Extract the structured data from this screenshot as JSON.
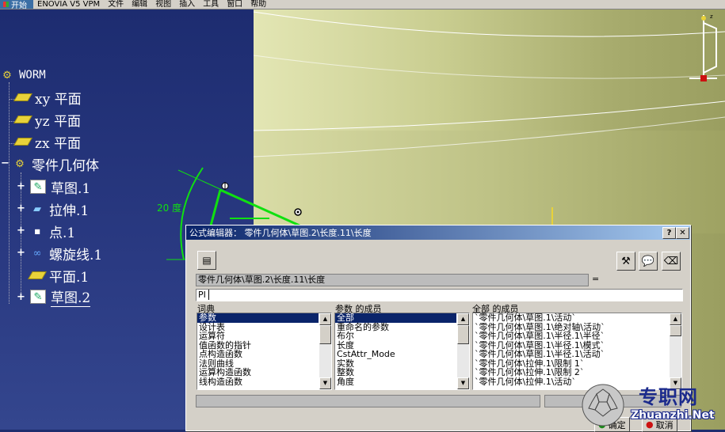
{
  "menubar": {
    "start": "开始",
    "items": [
      "ENOVIA V5 VPM",
      "文件",
      "编辑",
      "视图",
      "插入",
      "工具",
      "窗口",
      "帮助"
    ]
  },
  "tree": {
    "root": "WORM",
    "planes": [
      "xy 平面",
      "yz 平面",
      "zx 平面"
    ],
    "body": "零件几何体",
    "features": [
      "草图.1",
      "拉伸.1",
      "点.1",
      "螺旋线.1",
      "平面.1",
      "草图.2"
    ]
  },
  "sketch": {
    "angle_label": "20 度"
  },
  "compass": {
    "z_label": "z"
  },
  "dialog": {
    "title": "公式编辑器： 零件几何体\\草图.2\\长度.11\\长度",
    "help_btn": "?",
    "close_btn": "✕",
    "param_path": "零件几何体\\草图.2\\长度.11\\长度",
    "equals": "=",
    "formula_value": "PI",
    "dictionary_label": "词典",
    "members_label": "参数 的成员",
    "all_members_label": "全部 的成员",
    "dictionary_items": [
      "参数",
      "设计表",
      "运算符",
      "值函数的指针",
      "点构造函数",
      "法则曲线",
      "运算构造函数",
      "线构造函数"
    ],
    "member_items": [
      "全部",
      "重命名的参数",
      "布尔",
      "长度",
      "CstAttr_Mode",
      "实数",
      "整数",
      "角度"
    ],
    "all_items": [
      "`零件几何体\\草图.1\\活动`",
      "`零件几何体\\草图.1\\绝对轴\\活动`",
      "`零件几何体\\草图.1\\半径.1\\半径`",
      "`零件几何体\\草图.1\\半径.1\\模式`",
      "`零件几何体\\草图.1\\半径.1\\活动`",
      "`零件几何体\\拉伸.1\\限制 1`",
      "`零件几何体\\拉伸.1\\限制 2`",
      "`零件几何体\\拉伸.1\\活动`"
    ],
    "ok_label": "确定",
    "cancel_label": "取消"
  },
  "watermark": {
    "cn": "专职网",
    "url": "Zhuanzhi.Net"
  },
  "colors": {
    "selection": "#0a246a",
    "title_start": "#0a246a",
    "title_end": "#a6caf0",
    "sketch_green": "#10e010",
    "tree_bg": "#1e2d6e"
  }
}
